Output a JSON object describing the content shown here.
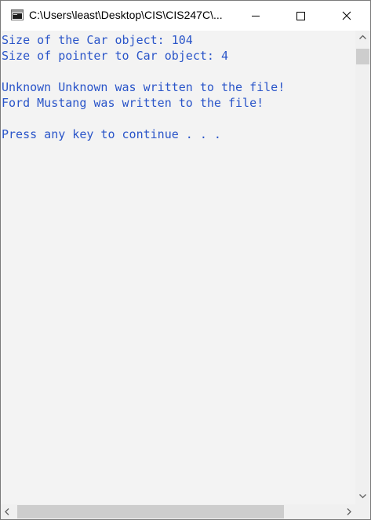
{
  "window": {
    "title": "C:\\Users\\least\\Desktop\\CIS\\CIS247C\\..."
  },
  "console": {
    "text_color": "#2a55c9",
    "lines": [
      "Size of the Car object: 104",
      "Size of pointer to Car object: 4",
      "",
      "Unknown Unknown was written to the file!",
      "Ford Mustang was written to the file!",
      "",
      "Press any key to continue . . ."
    ]
  },
  "icons": {
    "app": "console-window-icon",
    "minimize": "minimize-icon",
    "maximize": "maximize-icon",
    "close": "close-icon"
  }
}
